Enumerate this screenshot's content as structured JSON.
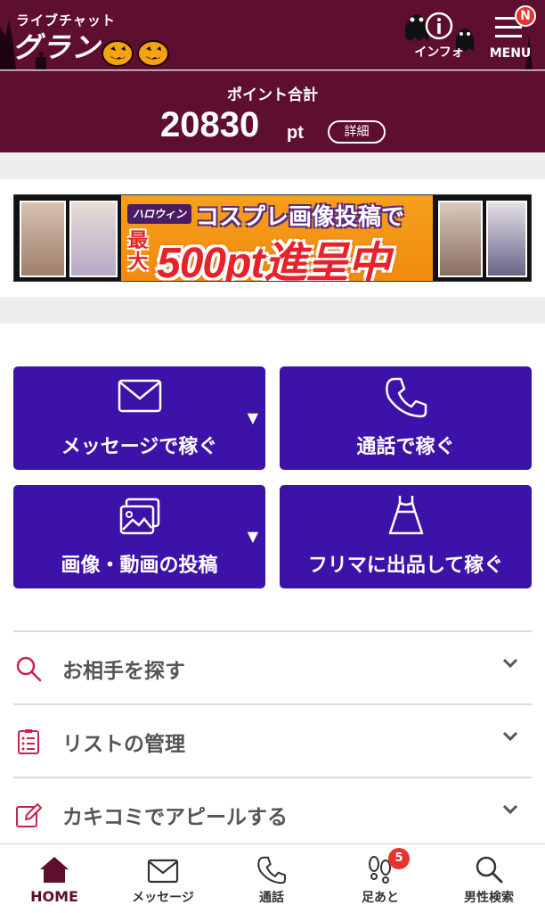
{
  "header": {
    "logo_sub": "ライブチャット",
    "logo_main": "グラン",
    "info_label": "インフォ",
    "menu_label": "MENU",
    "menu_badge": "N"
  },
  "points": {
    "title": "ポイント合計",
    "value": "20830",
    "unit": "pt",
    "detail_label": "詳細"
  },
  "banner": {
    "tag": "ハロウィン",
    "line1": "コスプレ画像投稿で",
    "line2_prefix": "最大",
    "line2": "500pt進呈中"
  },
  "tiles": [
    {
      "label": "メッセージで稼ぐ",
      "icon": "envelope-icon",
      "has_dropdown": true
    },
    {
      "label": "通話で稼ぐ",
      "icon": "phone-icon",
      "has_dropdown": false
    },
    {
      "label": "画像・動画の投稿",
      "icon": "images-icon",
      "has_dropdown": true
    },
    {
      "label": "フリマに出品して稼ぐ",
      "icon": "dress-icon",
      "has_dropdown": false
    }
  ],
  "menu": [
    {
      "label": "お相手を探す",
      "icon": "search-icon"
    },
    {
      "label": "リストの管理",
      "icon": "list-icon"
    },
    {
      "label": "カキコミでアピールする",
      "icon": "edit-icon"
    }
  ],
  "nav": [
    {
      "label": "HOME",
      "icon": "home-icon",
      "active": true
    },
    {
      "label": "メッセージ",
      "icon": "envelope-icon"
    },
    {
      "label": "通話",
      "icon": "phone-icon"
    },
    {
      "label": "足あと",
      "icon": "footprints-icon",
      "badge": "5"
    },
    {
      "label": "男性検索",
      "icon": "search-icon"
    }
  ],
  "colors": {
    "brand": "#5e0e2e",
    "tile": "#3d12a8",
    "badge": "#e8322e",
    "accent_icon": "#c8234a"
  }
}
